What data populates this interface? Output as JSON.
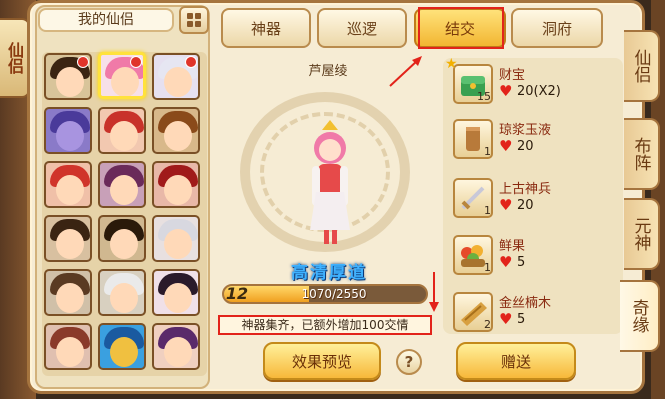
{
  "left_edge_tab": "仙侣",
  "left_panel": {
    "title": "我的仙侣"
  },
  "tabs": [
    {
      "label": "神器"
    },
    {
      "label": "巡逻"
    },
    {
      "label": "结交"
    },
    {
      "label": "洞府"
    }
  ],
  "character": {
    "name": "芦屋绫",
    "quality": "高清厚道",
    "level": "12",
    "exp_text": "1070/2550",
    "exp_fraction": 0.42,
    "notice": "神器集齐，已额外增加100交情"
  },
  "buttons": {
    "preview": "效果预览",
    "help": "?",
    "give": "赠送"
  },
  "gifts": [
    {
      "name": "财宝",
      "count": "15",
      "value": "20(X2)",
      "icon": "treasure-chest-icon"
    },
    {
      "name": "琼浆玉液",
      "count": "1",
      "value": "20",
      "icon": "wine-cup-icon"
    },
    {
      "name": "上古神兵",
      "count": "1",
      "value": "20",
      "icon": "sword-icon"
    },
    {
      "name": "鲜果",
      "count": "1",
      "value": "5",
      "icon": "fruit-basket-icon"
    },
    {
      "name": "金丝楠木",
      "count": "2",
      "value": "5",
      "icon": "wood-icon"
    }
  ],
  "right_tabs": [
    {
      "label": "仙侣"
    },
    {
      "label": "布阵"
    },
    {
      "label": "元神"
    },
    {
      "label": "奇缘"
    }
  ],
  "colors": {
    "accent": "#f2b632",
    "highlight": "#e2231a",
    "frame": "#a5743e"
  }
}
